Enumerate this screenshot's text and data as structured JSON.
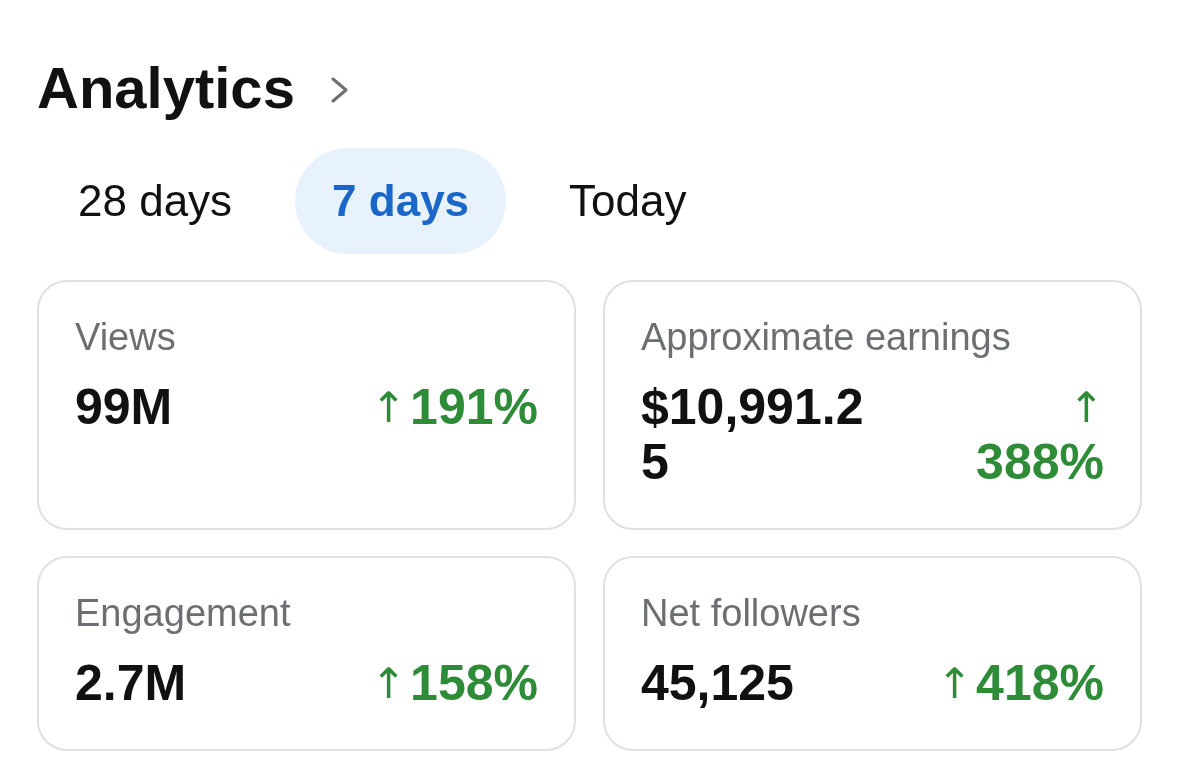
{
  "header": {
    "title": "Analytics"
  },
  "tabs": [
    {
      "label": "28 days",
      "selected": false
    },
    {
      "label": "7 days",
      "selected": true
    },
    {
      "label": "Today",
      "selected": false
    }
  ],
  "stats": [
    {
      "label": "Views",
      "value": "99M",
      "arrow": "↑",
      "change": "191%"
    },
    {
      "label": "Approximate earnings",
      "value": "$10,991.25",
      "arrow": "↑",
      "change": "388%"
    },
    {
      "label": "Engagement",
      "value": "2.7M",
      "arrow": "↑",
      "change": "158%"
    },
    {
      "label": "Net followers",
      "value": "45,125",
      "arrow": "↑",
      "change": "418%"
    }
  ]
}
